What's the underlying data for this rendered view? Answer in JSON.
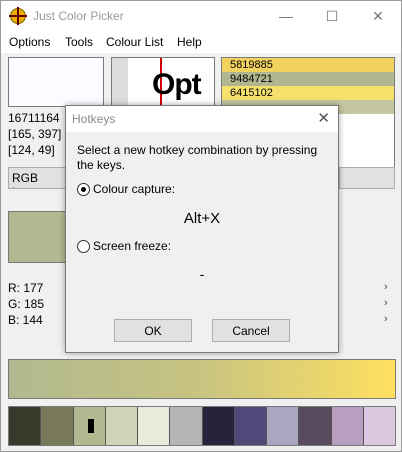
{
  "window": {
    "title": "Just Color Picker",
    "minimize": "—",
    "maximize": "☐",
    "close": "✕"
  },
  "menu": [
    "Options",
    "Tools",
    "Colour List",
    "Help"
  ],
  "info": {
    "value": "16711164",
    "coords": "[165, 397]",
    "offset": "[124, 49]"
  },
  "zoom_text": "Opt",
  "hex_list": [
    {
      "text": "5819885",
      "color": "#f2d25e"
    },
    {
      "text": "9484721",
      "color": "#b0b690"
    },
    {
      "text": "6415102",
      "color": "#f6e06c"
    },
    {
      "text": "",
      "color": "#c6c6a0"
    },
    {
      "text": "",
      "color": "#ffffff"
    },
    {
      "text": "",
      "color": "#ffffff"
    },
    {
      "text": "",
      "color": "#ffffff"
    },
    {
      "text": "",
      "color": "#ffffff"
    }
  ],
  "mode": "RGB Integer",
  "current_color": "#b1b990",
  "rgb": {
    "r": "R: 177",
    "g": "G: 185",
    "b": "B: 144"
  },
  "palette": [
    "#3a3a2c",
    "#787a5a",
    "#b1b990",
    "#cfd3b8",
    "#e9e9dc",
    "#b4b4b4",
    "#26243a",
    "#4f4878",
    "#a8a6c0",
    "#5a4a5e",
    "#b89ec0",
    "#dcc8e0"
  ],
  "dialog": {
    "title": "Hotkeys",
    "close": "✕",
    "instruction": "Select a new hotkey combination by pressing the keys.",
    "option1": "Colour capture:",
    "option1_key": "Alt+X",
    "option2": "Screen freeze:",
    "option2_key": "-",
    "ok": "OK",
    "cancel": "Cancel"
  }
}
